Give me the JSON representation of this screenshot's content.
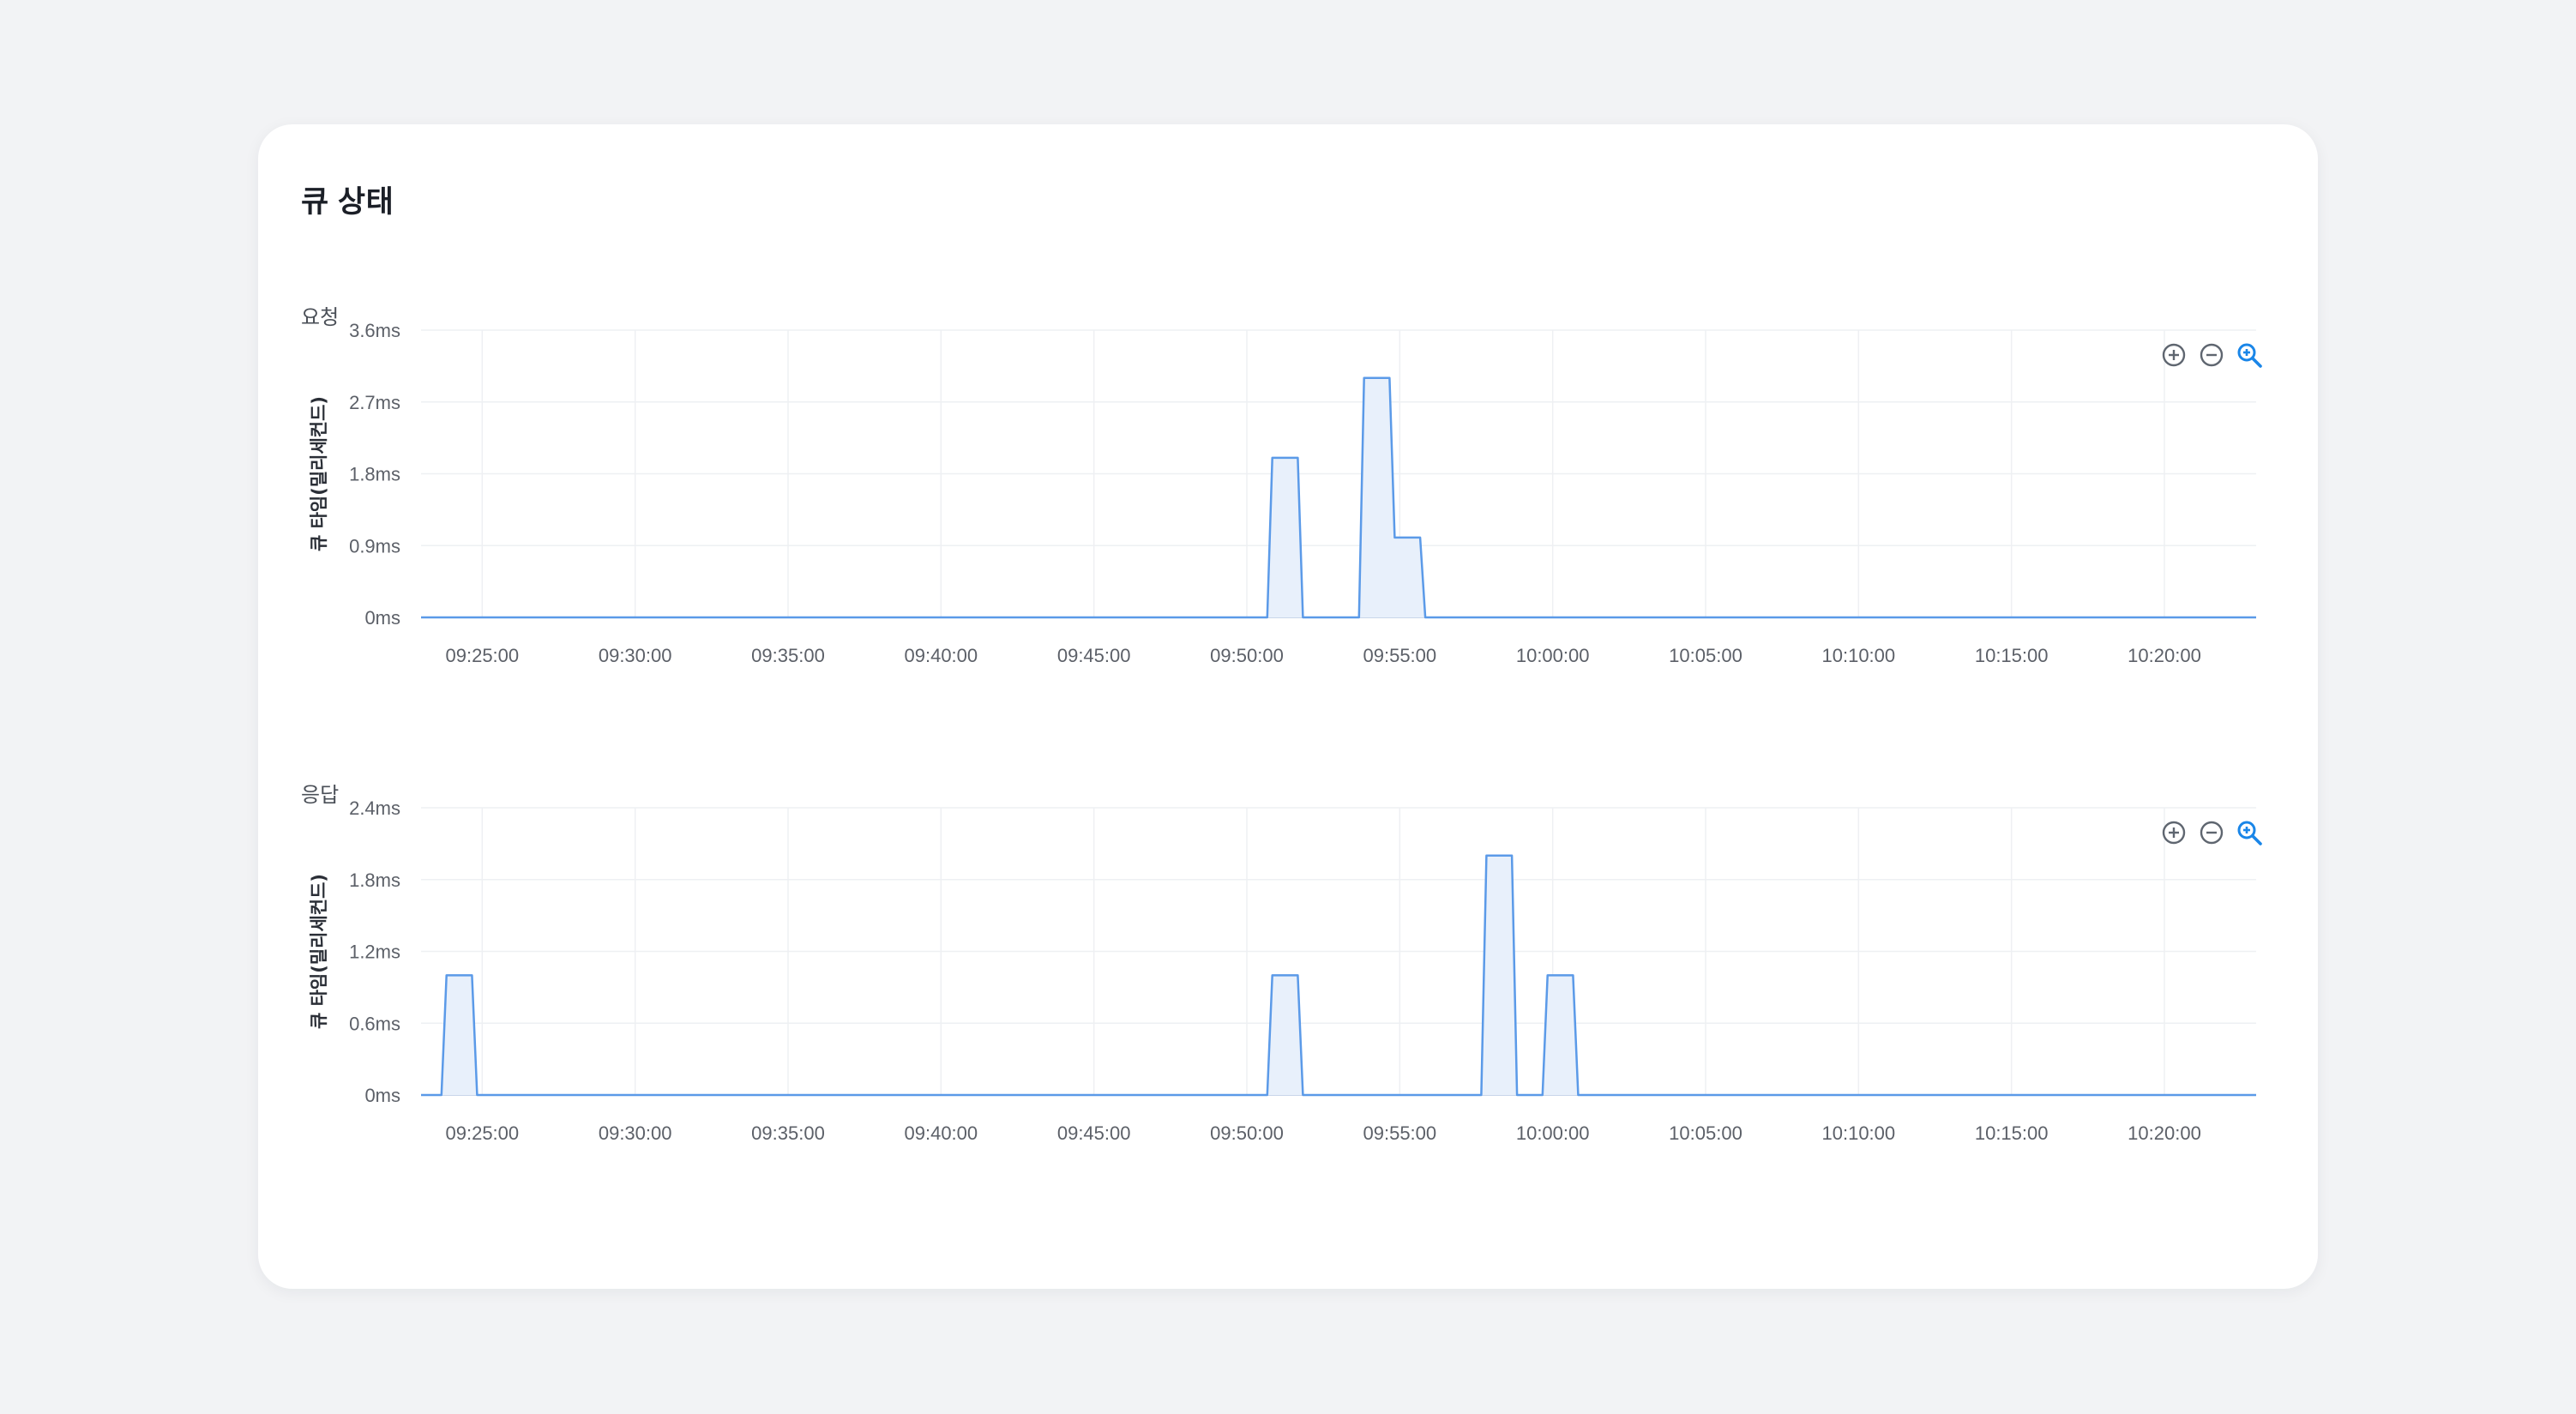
{
  "card": {
    "title": "큐 상태"
  },
  "colors": {
    "line": "#5b9ae8",
    "fill": "#e8f0fb",
    "grid": "#eef0f3",
    "axis": "#c9d6ea",
    "zoom_active": "#1a86e8",
    "icon": "#5f6670"
  },
  "controls": {
    "icons": [
      "zoom-in-icon",
      "zoom-out-icon",
      "zoom-reset-icon"
    ]
  },
  "chart_data": [
    {
      "id": "request",
      "section_label": "요청",
      "type": "area",
      "ylabel": "큐 타임(밀리세컨드)",
      "ylim": [
        0,
        3.6
      ],
      "y_ticks": [
        "0ms",
        "0.9ms",
        "1.8ms",
        "2.7ms",
        "3.6ms"
      ],
      "y_tick_values": [
        0,
        0.9,
        1.8,
        2.7,
        3.6
      ],
      "x_range": [
        "09:23:00",
        "10:23:00"
      ],
      "x_ticks": [
        "09:25:00",
        "09:30:00",
        "09:35:00",
        "09:40:00",
        "09:45:00",
        "09:50:00",
        "09:55:00",
        "10:00:00",
        "10:05:00",
        "10:10:00",
        "10:15:00",
        "10:20:00"
      ],
      "grid": true,
      "series": [
        {
          "x": [
            "09:23:00",
            "09:50:40",
            "09:50:50",
            "09:51:40",
            "09:51:50",
            "09:53:40",
            "09:53:50",
            "09:54:40",
            "09:54:50",
            "09:55:40",
            "09:55:50",
            "10:23:00"
          ],
          "y": [
            0,
            0,
            2,
            2,
            0,
            0,
            3,
            3,
            1,
            1,
            0,
            0
          ]
        }
      ]
    },
    {
      "id": "response",
      "section_label": "응답",
      "type": "area",
      "ylabel": "큐 타임(밀리세컨드)",
      "ylim": [
        0,
        2.4
      ],
      "y_ticks": [
        "0ms",
        "0.6ms",
        "1.2ms",
        "1.8ms",
        "2.4ms"
      ],
      "y_tick_values": [
        0,
        0.6,
        1.2,
        1.8,
        2.4
      ],
      "x_range": [
        "09:23:00",
        "10:23:00"
      ],
      "x_ticks": [
        "09:25:00",
        "09:30:00",
        "09:35:00",
        "09:40:00",
        "09:45:00",
        "09:50:00",
        "09:55:00",
        "10:00:00",
        "10:05:00",
        "10:10:00",
        "10:15:00",
        "10:20:00"
      ],
      "grid": true,
      "series": [
        {
          "x": [
            "09:23:00",
            "09:23:40",
            "09:23:50",
            "09:24:40",
            "09:24:50",
            "09:50:40",
            "09:50:50",
            "09:51:40",
            "09:51:50",
            "09:57:40",
            "09:57:50",
            "09:58:40",
            "09:58:50",
            "09:59:40",
            "09:59:50",
            "10:00:40",
            "10:00:50",
            "10:23:00"
          ],
          "y": [
            0,
            0,
            1,
            1,
            0,
            0,
            1,
            1,
            0,
            0,
            2,
            2,
            0,
            0,
            1,
            1,
            0,
            0
          ]
        }
      ]
    }
  ]
}
